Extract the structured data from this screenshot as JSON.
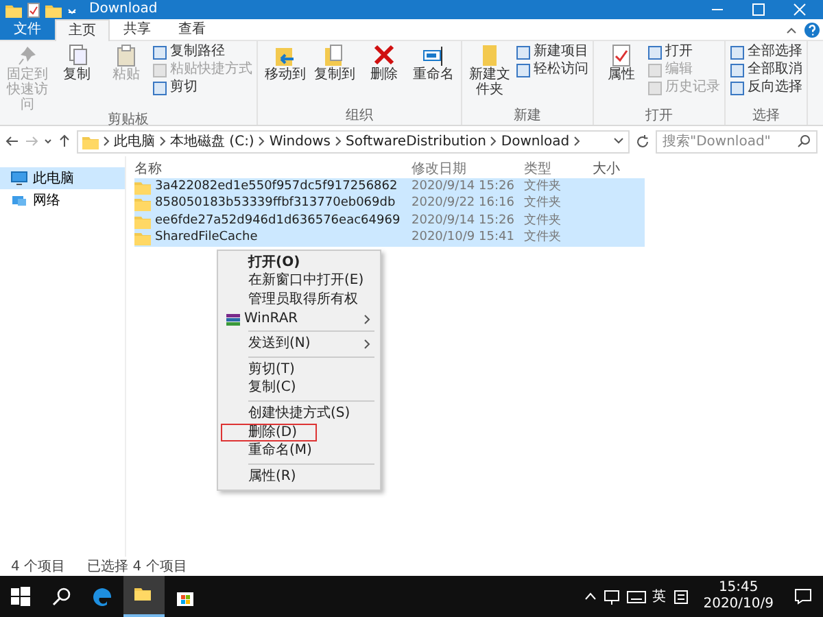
{
  "window": {
    "title": "Download"
  },
  "ribbon_tabs": [
    {
      "label": "文件",
      "kind": "file",
      "selected": false
    },
    {
      "label": "主页",
      "kind": "tab",
      "selected": true
    },
    {
      "label": "共享",
      "kind": "tab",
      "selected": false
    },
    {
      "label": "查看",
      "kind": "tab",
      "selected": false
    }
  ],
  "ribbon_groups": [
    {
      "label": "剪贴板",
      "items": [
        {
          "label": "固定到快速访问",
          "kind": "big",
          "disabled": true
        },
        {
          "label": "复制",
          "kind": "big",
          "disabled": false
        },
        {
          "label": "粘贴",
          "kind": "big",
          "disabled": true
        },
        {
          "label": "复制路径",
          "kind": "small",
          "disabled": false
        },
        {
          "label": "粘贴快捷方式",
          "kind": "small",
          "disabled": true
        },
        {
          "label": "剪切",
          "kind": "small",
          "disabled": false
        }
      ]
    },
    {
      "label": "组织",
      "items": [
        {
          "label": "移动到",
          "kind": "big",
          "disabled": false
        },
        {
          "label": "复制到",
          "kind": "big",
          "disabled": false
        },
        {
          "label": "删除",
          "kind": "big",
          "disabled": false
        },
        {
          "label": "重命名",
          "kind": "big",
          "disabled": false
        }
      ]
    },
    {
      "label": "新建",
      "items": [
        {
          "label": "新建文件夹",
          "kind": "big",
          "disabled": false
        },
        {
          "label": "新建项目",
          "kind": "small",
          "disabled": false
        },
        {
          "label": "轻松访问",
          "kind": "small",
          "disabled": false
        }
      ]
    },
    {
      "label": "打开",
      "items": [
        {
          "label": "属性",
          "kind": "big",
          "disabled": false
        },
        {
          "label": "打开",
          "kind": "small",
          "disabled": false
        },
        {
          "label": "编辑",
          "kind": "small",
          "disabled": true
        },
        {
          "label": "历史记录",
          "kind": "small",
          "disabled": true
        }
      ]
    },
    {
      "label": "选择",
      "items": [
        {
          "label": "全部选择",
          "kind": "small",
          "disabled": false
        },
        {
          "label": "全部取消",
          "kind": "small",
          "disabled": false
        },
        {
          "label": "反向选择",
          "kind": "small",
          "disabled": false
        }
      ]
    }
  ],
  "address": {
    "path": [
      "此电脑",
      "本地磁盘 (C:)",
      "Windows",
      "SoftwareDistribution",
      "Download"
    ],
    "search_placeholder": "搜索\"Download\""
  },
  "nav": [
    {
      "label": "此电脑",
      "selected": true
    },
    {
      "label": "网络",
      "selected": false
    }
  ],
  "columns": [
    "名称",
    "修改日期",
    "类型",
    "大小"
  ],
  "rows": [
    {
      "name": "3a422082ed1e550f957dc5f917256862",
      "date": "2020/9/14 15:26",
      "type": "文件夹",
      "selected": true
    },
    {
      "name": "858050183b53339ffbf313770eb069db",
      "date": "2020/9/22 16:16",
      "type": "文件夹",
      "selected": true
    },
    {
      "name": "ee6fde27a52d946d1d636576eac64969",
      "date": "2020/9/14 15:26",
      "type": "文件夹",
      "selected": true
    },
    {
      "name": "SharedFileCache",
      "date": "2020/10/9 15:41",
      "type": "文件夹",
      "selected": true
    }
  ],
  "context_menu": [
    {
      "kind": "item",
      "label": "打开(O)",
      "bold": true,
      "highlighted": false
    },
    {
      "kind": "item",
      "label": "在新窗口中打开(E)",
      "bold": false,
      "highlighted": false
    },
    {
      "kind": "item",
      "label": "管理员取得所有权",
      "bold": false,
      "highlighted": false
    },
    {
      "kind": "submenu",
      "label": "WinRAR",
      "bold": false,
      "highlighted": false
    },
    {
      "kind": "separator"
    },
    {
      "kind": "submenu",
      "label": "发送到(N)",
      "bold": false,
      "highlighted": false
    },
    {
      "kind": "separator"
    },
    {
      "kind": "item",
      "label": "剪切(T)",
      "bold": false,
      "highlighted": false
    },
    {
      "kind": "item",
      "label": "复制(C)",
      "bold": false,
      "highlighted": false
    },
    {
      "kind": "separator"
    },
    {
      "kind": "item",
      "label": "创建快捷方式(S)",
      "bold": false,
      "highlighted": false
    },
    {
      "kind": "item",
      "label": "删除(D)",
      "bold": false,
      "highlighted": true
    },
    {
      "kind": "item",
      "label": "重命名(M)",
      "bold": false,
      "highlighted": false
    },
    {
      "kind": "separator"
    },
    {
      "kind": "item",
      "label": "属性(R)",
      "bold": false,
      "highlighted": false
    }
  ],
  "status_bar": [
    "4 个项目",
    "已选择 4 个项目"
  ],
  "taskbar": {
    "ime": "英",
    "time": "15:45",
    "date": "2020/10/9"
  }
}
